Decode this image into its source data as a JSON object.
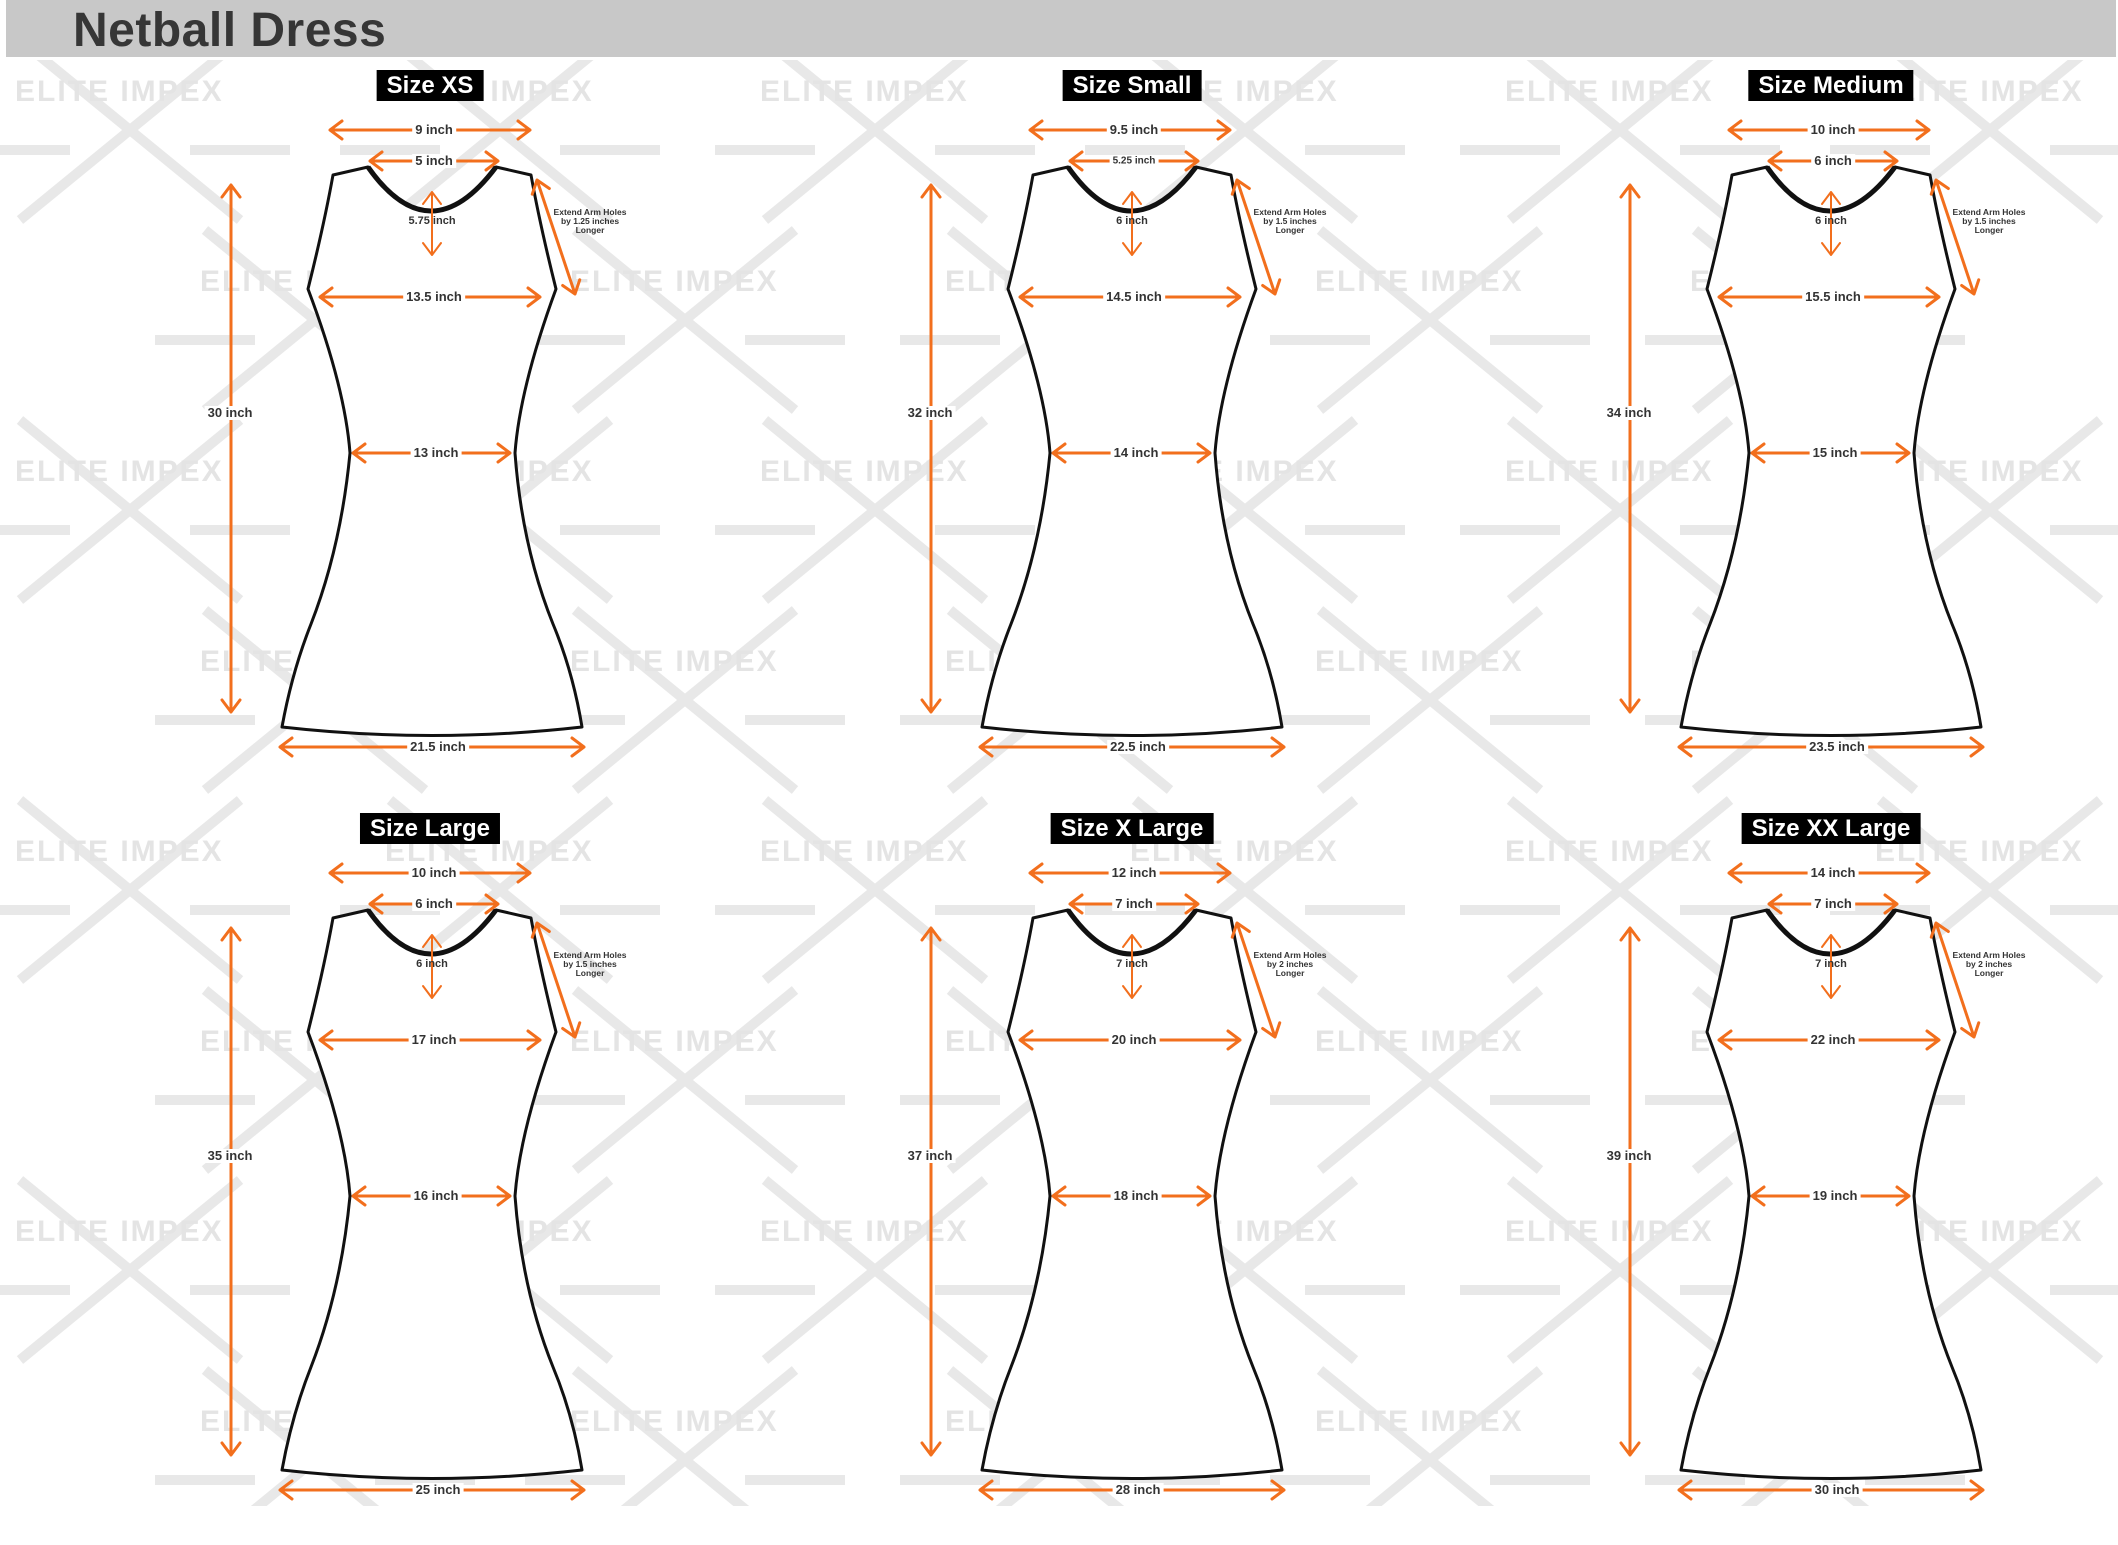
{
  "title": "Netball Dress",
  "watermark": "ELITE IMPEX",
  "colors": {
    "arrow": "#f26f1d",
    "outline": "#111111",
    "header_bg": "#c8c8c8",
    "title": "#363636",
    "label_bg": "#000000",
    "label_text": "#ffffff",
    "watermark": "#e4e4e4"
  },
  "sizes": [
    {
      "label": "Size XS",
      "shoulder": "9 inch",
      "neck_width": "5 inch",
      "neck_depth": "5.75 inch",
      "chest": "13.5 inch",
      "length": "30 inch",
      "waist": "13 inch",
      "hem": "21.5 inch",
      "arm_note": "Extend Arm Holes\nby 1.25 inches\nLonger"
    },
    {
      "label": "Size Small",
      "shoulder": "9.5 inch",
      "neck_width": "5.25 inch",
      "neck_depth": "6 inch",
      "chest": "14.5 inch",
      "length": "32 inch",
      "waist": "14 inch",
      "hem": "22.5 inch",
      "arm_note": "Extend Arm Holes\nby 1.5 inches\nLonger"
    },
    {
      "label": "Size Medium",
      "shoulder": "10 inch",
      "neck_width": "6 inch",
      "neck_depth": "6 inch",
      "chest": "15.5 inch",
      "length": "34 inch",
      "waist": "15 inch",
      "hem": "23.5 inch",
      "arm_note": "Extend Arm Holes\nby 1.5 inches\nLonger"
    },
    {
      "label": "Size Large",
      "shoulder": "10 inch",
      "neck_width": "6 inch",
      "neck_depth": "6 inch",
      "chest": "17 inch",
      "length": "35 inch",
      "waist": "16 inch",
      "hem": "25 inch",
      "arm_note": "Extend Arm Holes\nby 1.5 inches\nLonger"
    },
    {
      "label": "Size X Large",
      "shoulder": "12 inch",
      "neck_width": "7 inch",
      "neck_depth": "7 inch",
      "chest": "20 inch",
      "length": "37 inch",
      "waist": "18 inch",
      "hem": "28 inch",
      "arm_note": "Extend Arm Holes\nby 2 inches\nLonger"
    },
    {
      "label": "Size XX Large",
      "shoulder": "14 inch",
      "neck_width": "7 inch",
      "neck_depth": "7 inch",
      "chest": "22 inch",
      "length": "39 inch",
      "waist": "19 inch",
      "hem": "30 inch",
      "arm_note": "Extend Arm Holes\nby 2 inches\nLonger"
    }
  ]
}
